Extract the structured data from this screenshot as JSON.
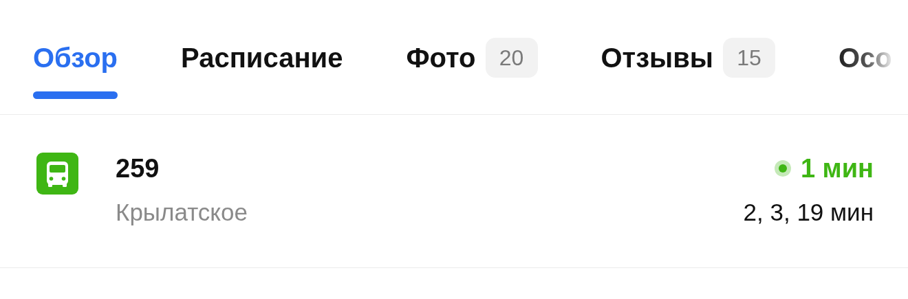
{
  "tabs": [
    {
      "label": "Обзор",
      "selected": true
    },
    {
      "label": "Расписание",
      "selected": false
    },
    {
      "label": "Фото",
      "selected": false,
      "badge": "20"
    },
    {
      "label": "Отзывы",
      "selected": false,
      "badge": "15"
    },
    {
      "label": "Осо",
      "selected": false,
      "faded": true
    }
  ],
  "routes": [
    {
      "kind": "bus",
      "number": "259",
      "destination": "Крылатское",
      "next": "1 мин",
      "later": "2, 3, 19 мин"
    }
  ]
}
